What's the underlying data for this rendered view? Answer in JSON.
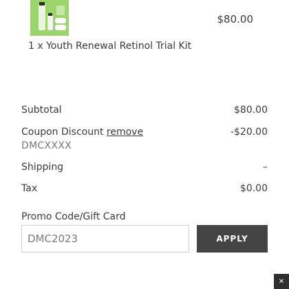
{
  "cart_item": {
    "price": "$80.00",
    "title": "1 x Youth Renewal Retinol Trial Kit"
  },
  "summary": {
    "subtotal_label": "Subtotal",
    "subtotal_value": "$80.00",
    "coupon_label": "Coupon Discount",
    "coupon_remove": "remove",
    "coupon_value": "-$20.00",
    "coupon_code": "DMCXXXX",
    "shipping_label": "Shipping",
    "shipping_value": "–",
    "tax_label": "Tax",
    "tax_value": "$0.00"
  },
  "promo": {
    "label": "Promo Code/Gift Card",
    "input_value": "DMC2023",
    "apply_label": "APPLY"
  },
  "colors": {
    "product_green": "#9bd46a",
    "apply_button_bg": "#444444",
    "text": "#3a3a3a"
  }
}
